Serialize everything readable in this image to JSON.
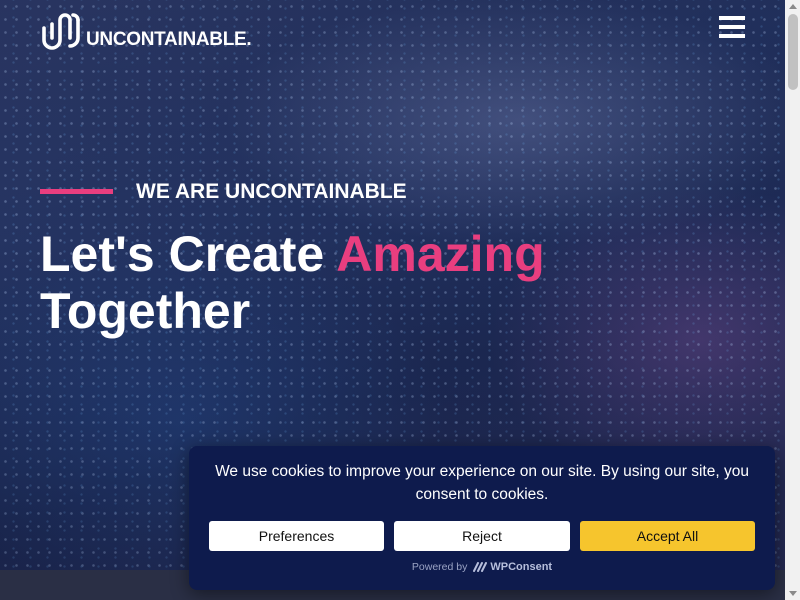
{
  "header": {
    "logo_text": "UNCONTAINABLE.",
    "menu_icon": "hamburger-menu-icon"
  },
  "hero": {
    "eyebrow": "WE ARE UNCONTAINABLE",
    "headline_part1": "Let's Create ",
    "headline_accent": "Amazing",
    "headline_part2": "Together",
    "accent_color": "#e93e7f"
  },
  "cookie_banner": {
    "message": "We use cookies to improve your experience on our site. By using our site, you consent to cookies.",
    "preferences_label": "Preferences",
    "reject_label": "Reject",
    "accept_label": "Accept All",
    "powered_by_label": "Powered by",
    "powered_by_brand": "WPConsent",
    "background_color": "#0e1b4d",
    "accept_color": "#f6c52d"
  }
}
